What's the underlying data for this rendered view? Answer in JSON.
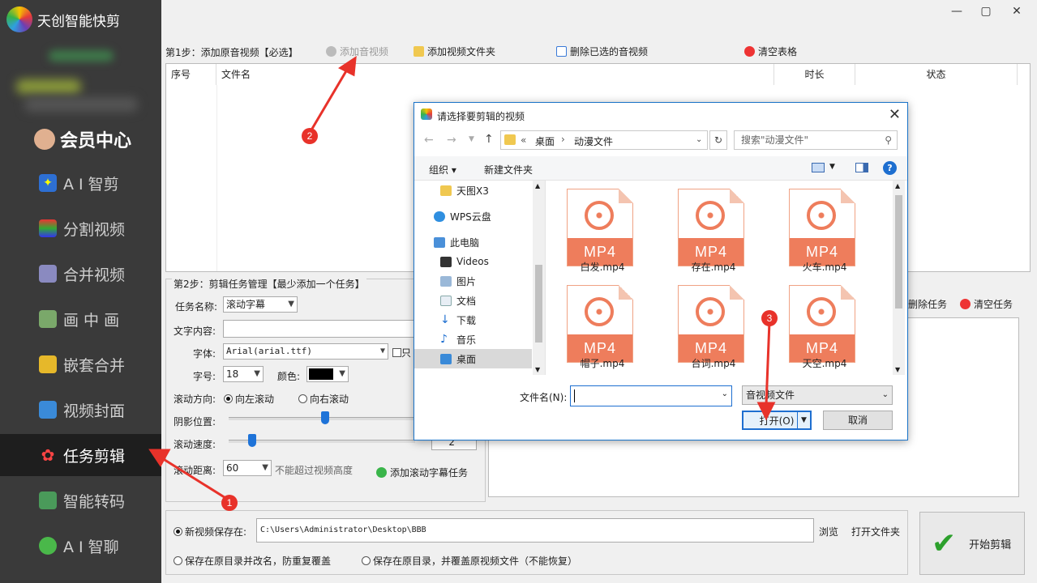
{
  "app": {
    "title": "天创智能快剪",
    "vip": "会员中心",
    "nav": [
      {
        "label": "A I 智剪",
        "icon": "ai-clip-icon"
      },
      {
        "label": "分割视频",
        "icon": "split-icon"
      },
      {
        "label": "合并视频",
        "icon": "merge-icon"
      },
      {
        "label": "画 中 画",
        "icon": "pip-icon"
      },
      {
        "label": "嵌套合并",
        "icon": "nest-icon"
      },
      {
        "label": "视频封面",
        "icon": "cover-icon"
      },
      {
        "label": "任务剪辑",
        "icon": "flower-icon"
      },
      {
        "label": "智能转码",
        "icon": "transcode-icon"
      },
      {
        "label": "A I 智聊",
        "icon": "chat-icon"
      }
    ]
  },
  "step1": {
    "label": "第1步：添加原音视频【必选】",
    "add_av": "添加音视频",
    "add_folder": "添加视频文件夹",
    "delete_selected": "删除已选的音视频",
    "clear_table": "清空表格",
    "columns": [
      "序号",
      "文件名",
      "时长",
      "状态"
    ]
  },
  "step2": {
    "label": "第2步：剪辑任务管理【最少添加一个任务】",
    "task_name_label": "任务名称:",
    "task_name_value": "滚动字幕",
    "text_content_label": "文字内容:",
    "font_label": "字体:",
    "font_value": "Arial(arial.ttf)",
    "only_label": "只",
    "size_label": "字号:",
    "size_value": "18",
    "color_label": "颜色:",
    "direction_label": "滚动方向:",
    "dir_left": "向左滚动",
    "dir_right": "向右滚动",
    "shadow_label": "阴影位置:",
    "speed_label": "滚动速度:",
    "speed_value": "2",
    "distance_label": "滚动距离:",
    "distance_value": "60",
    "distance_hint": "不能超过视频高度",
    "add_task": "添加滚动字幕任务"
  },
  "tasks": {
    "delete_task": "删除任务",
    "clear_task": "清空任务"
  },
  "output": {
    "new_save_label": "新视频保存在:",
    "save_path": "C:\\Users\\Administrator\\Desktop\\BBB",
    "browse": "浏览",
    "open_folder": "打开文件夹",
    "opt_rename": "保存在原目录并改名，防重复覆盖",
    "opt_overwrite": "保存在原目录，并覆盖原视频文件（不能恢复）",
    "start": "开始剪辑"
  },
  "dialog": {
    "title": "请选择要剪辑的视频",
    "breadcrumb": [
      "«",
      "桌面",
      "›",
      "动漫文件"
    ],
    "search_placeholder": "搜索\"动漫文件\"",
    "organize": "组织 ▾",
    "new_folder": "新建文件夹",
    "nav_items": [
      "天图X3",
      "WPS云盘",
      "此电脑",
      "Videos",
      "图片",
      "文档",
      "下载",
      "音乐",
      "桌面"
    ],
    "files": [
      "白发.mp4",
      "存在.mp4",
      "火车.mp4",
      "帽子.mp4",
      "台词.mp4",
      "天空.mp4"
    ],
    "file_badge": "MP4",
    "filename_label": "文件名(N):",
    "filetype_value": "音视频文件",
    "open": "打开(O)",
    "cancel": "取消"
  },
  "annotations": [
    "1",
    "2",
    "3"
  ],
  "colors": {
    "sidebar": "#3a3a3a",
    "active": "#1e1e1e",
    "accent": "#ee7d5c",
    "badge": "#e8322a"
  }
}
